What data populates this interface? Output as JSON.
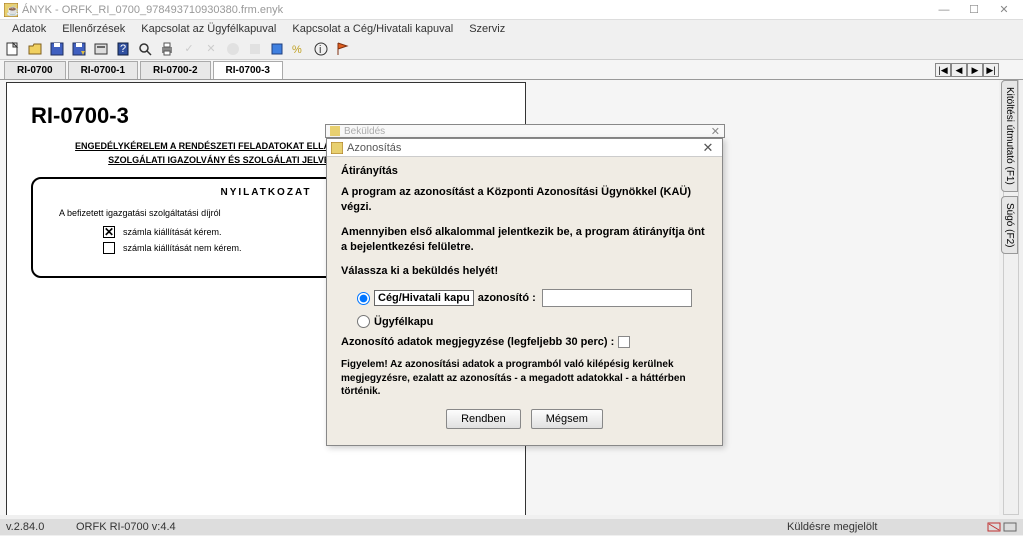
{
  "window": {
    "title": "ÁNYK - ORFK_RI_0700_978493710930380.frm.enyk",
    "minimize": "—",
    "maximize": "☐",
    "close": "✕"
  },
  "menu": {
    "items": [
      "Adatok",
      "Ellenőrzések",
      "Kapcsolat az Ügyfélkapuval",
      "Kapcsolat a Cég/Hivatali kapuval",
      "Szerviz"
    ]
  },
  "tabs": {
    "items": [
      "RI-0700",
      "RI-0700-1",
      "RI-0700-2",
      "RI-0700-3"
    ],
    "nav": [
      "|◀",
      "◀",
      "▶",
      "▶|"
    ]
  },
  "page": {
    "heading": "RI-0700-3",
    "sub1": "ENGEDÉLYKÉRELEM A RENDÉSZETI FELADATOKAT ELLÁTÓ SZEMÉLY JELVÉNYÉNEK,",
    "sub2": "SZOLGÁLATI IGAZOLVÁNY ÉS SZOLGÁLATI JELVÉNYÉNEK KIADÁSÁRA",
    "boxhdr": "NYILATKOZAT",
    "intro": "A befizetett igazgatási szolgáltatási díjról",
    "opt1": "számla kiállítását kérem.",
    "opt2": "számla kiállítását nem kérem."
  },
  "sidetabs": {
    "t1": "Kitöltési útmutató (F1)",
    "t2": "Súgó (F2)"
  },
  "dialog_back": {
    "title": "Beküldés"
  },
  "dialog": {
    "title": "Azonosítás",
    "section": "Átirányítás",
    "p1": "A program az azonosítást a Központi Azonosítási Ügynökkel (KAÜ) végzi.",
    "p2": "Amennyiben első alkalommal jelentkezik be, a program átirányítja önt a bejelentkezési felületre.",
    "prompt": "Válassza ki a beküldés helyét!",
    "r1": "Cég/Hivatali kapu",
    "r1b": "azonosító :",
    "r2": "Ügyfélkapu",
    "remember": "Azonosító adatok megjegyzése (legfeljebb 30 perc) :",
    "note": "Figyelem! Az azonosítási adatok a programból való kilépésig kerülnek megjegyzésre, ezalatt az azonosítás - a megadott adatokkal - a háttérben történik.",
    "ok": "Rendben",
    "cancel": "Mégsem"
  },
  "status": {
    "ver": "v.2.84.0",
    "form": "ORFK  RI-0700 v:4.4",
    "state": "Küldésre megjelölt"
  }
}
